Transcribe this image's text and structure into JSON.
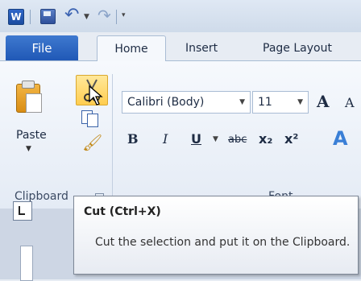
{
  "quick_access": {
    "app_icon_letter": "W",
    "save_icon": "save-icon",
    "undo_icon": "undo-icon",
    "redo_icon": "redo-icon"
  },
  "tabs": {
    "file": "File",
    "home": "Home",
    "insert": "Insert",
    "page_layout": "Page Layout"
  },
  "clipboard": {
    "paste_label": "Paste",
    "group_label": "Clipboard"
  },
  "font": {
    "name": "Calibri (Body)",
    "size": "11",
    "grow_glyph": "A",
    "shrink_glyph": "A",
    "bold_glyph": "B",
    "italic_glyph": "I",
    "underline_glyph": "U",
    "strike_glyph": "abc",
    "subscript_glyph": "x₂",
    "superscript_glyph": "x²",
    "text_effect_glyph": "A",
    "group_label": "Font"
  },
  "tooltip": {
    "title": "Cut (Ctrl+X)",
    "body": "Cut the selection and put it on the Clipboard."
  },
  "colors": {
    "file_tab": "#2058b6",
    "cut_highlight": "#ffcd4f"
  }
}
